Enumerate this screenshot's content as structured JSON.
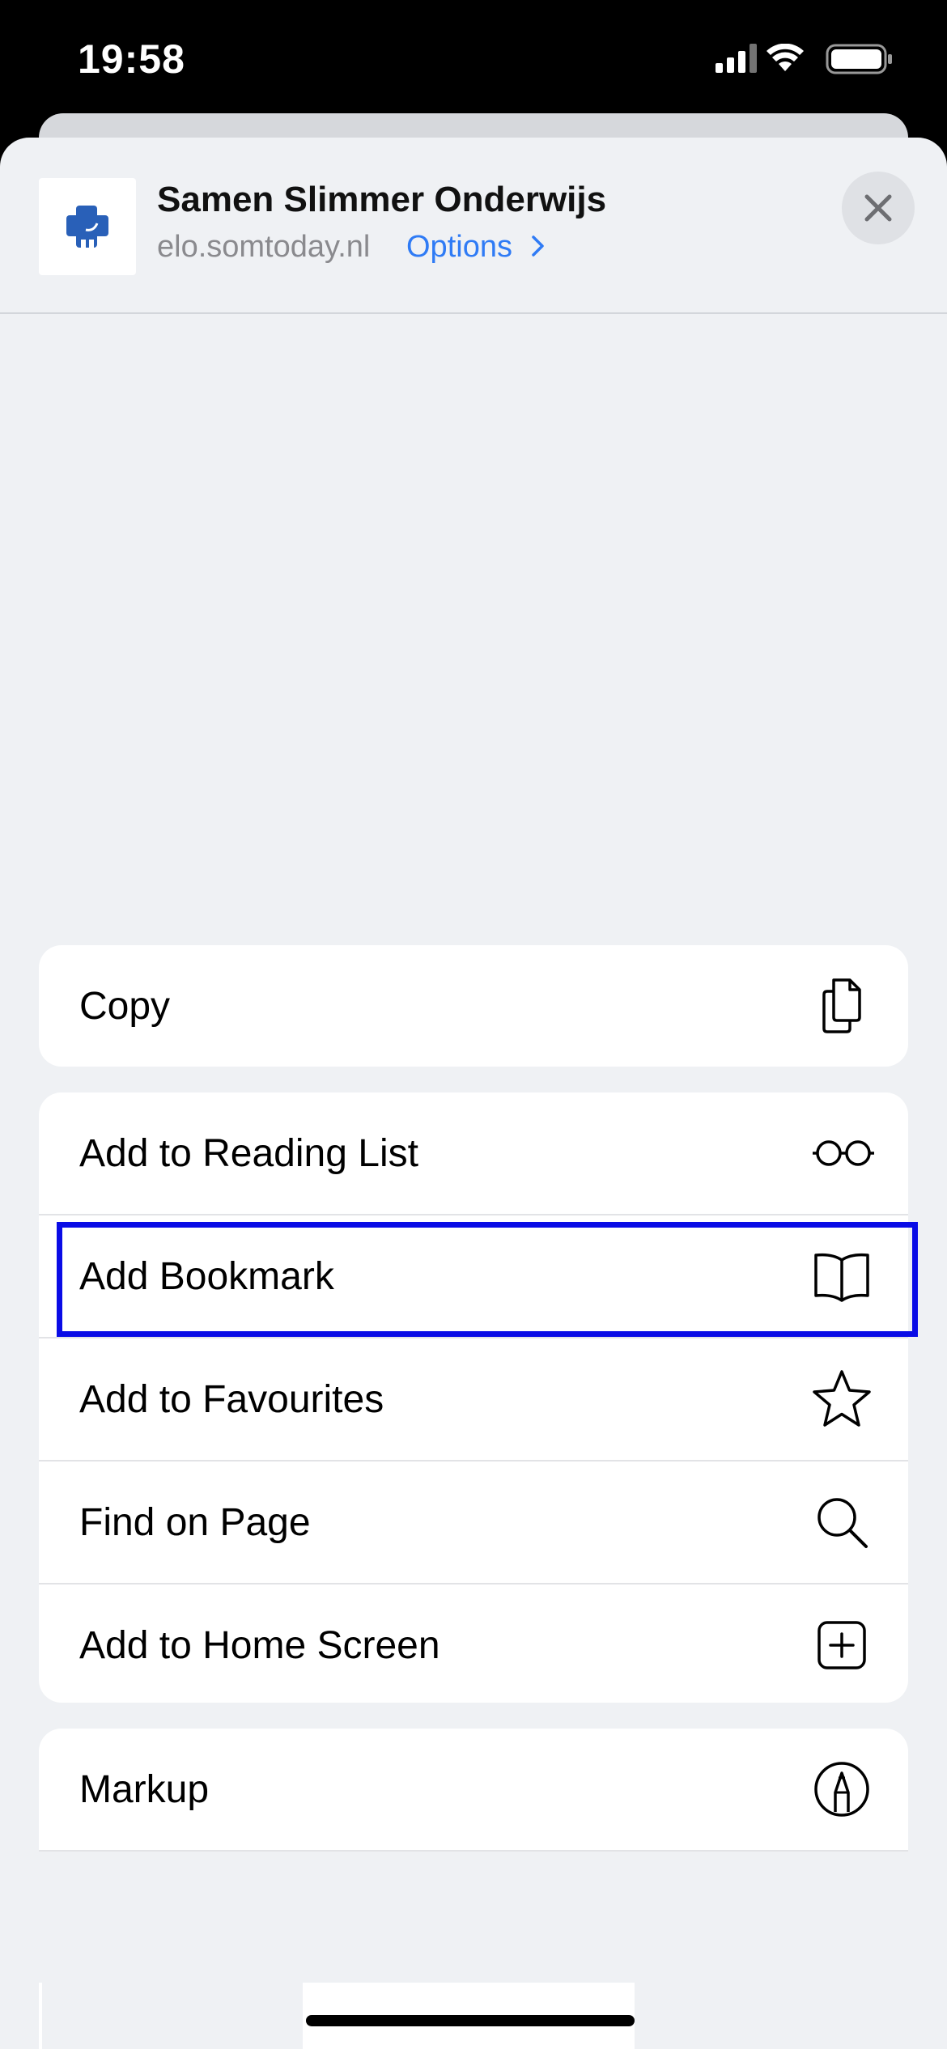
{
  "status_bar": {
    "time": "19:58",
    "icons": [
      "signal-icon",
      "wifi-icon",
      "battery-icon"
    ]
  },
  "header": {
    "site_icon": "somtoday-logo",
    "title": "Samen Slimmer Onderwijs",
    "url": "elo.somtoday.nl",
    "options_label": "Options",
    "options_icon": "chevron-right-icon",
    "close_icon": "close-icon"
  },
  "actions": {
    "copy": {
      "label": "Copy",
      "icon": "copy-icon"
    },
    "group_main": [
      {
        "label": "Add to Reading List",
        "icon": "glasses-icon"
      },
      {
        "label": "Add Bookmark",
        "icon": "book-icon",
        "highlighted": true
      },
      {
        "label": "Add to Favourites",
        "icon": "star-icon"
      },
      {
        "label": "Find on Page",
        "icon": "search-icon"
      },
      {
        "label": "Add to Home Screen",
        "icon": "plus-square-icon"
      }
    ],
    "markup": {
      "label": "Markup",
      "icon": "markup-pen-icon"
    }
  },
  "colors": {
    "accent": "#2f7bf5",
    "highlight_box": "#0a0ce6",
    "sheet_bg": "#eff1f4",
    "logo_blue": "#2960b8"
  }
}
